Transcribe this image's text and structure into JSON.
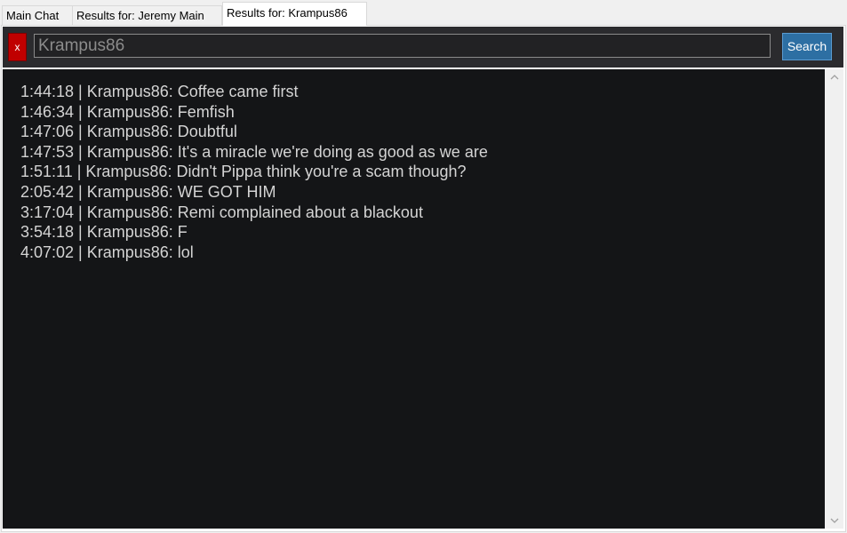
{
  "tabs": [
    {
      "label": "Main Chat",
      "active": false
    },
    {
      "label": "Results for: Jeremy Main",
      "active": false
    },
    {
      "label": "Results for: Krampus86",
      "active": true
    }
  ],
  "search": {
    "clear_label": "x",
    "query": "Krampus86",
    "button_label": "Search"
  },
  "results": [
    "1:44:18 | Krampus86: Coffee came first",
    "1:46:34 | Krampus86: Femfish",
    "1:47:06 | Krampus86: Doubtful",
    "1:47:53 | Krampus86: It's a miracle we're doing as good as we are",
    "1:51:11 | Krampus86: Didn't Pippa think you're a scam though?",
    "2:05:42 | Krampus86: WE GOT HIM",
    "3:17:04 | Krampus86: Remi complained about a blackout",
    "3:54:18 | Krampus86: F",
    "4:07:02 | Krampus86: lol"
  ],
  "scrollbar": {
    "up_icon": "chevron-up-icon",
    "down_icon": "chevron-down-icon"
  },
  "colors": {
    "results_background": "#141517",
    "search_bar_background": "#2b2b2e",
    "clear_button": "#c00000",
    "search_button": "#2d6fa3",
    "result_text": "#d4d4d4"
  }
}
